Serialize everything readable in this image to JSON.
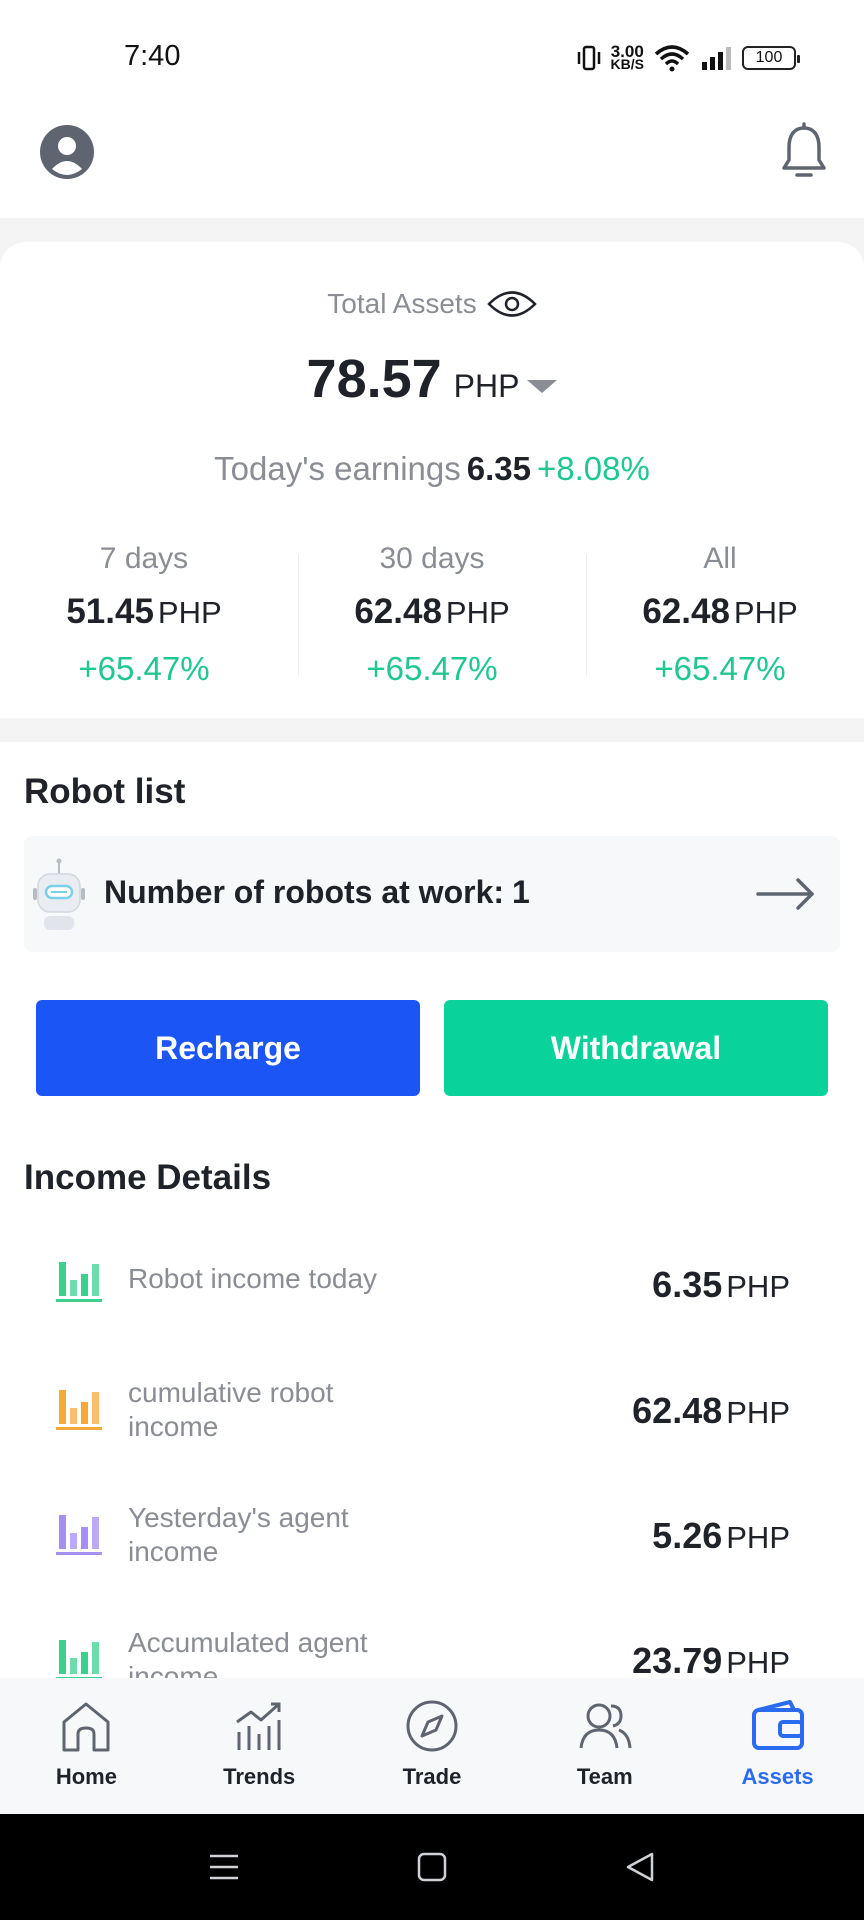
{
  "status": {
    "time": "7:40",
    "net_speed_value": "3.00",
    "net_speed_unit": "KB/S",
    "battery": "100"
  },
  "assets": {
    "total_label": "Total Assets",
    "total_value": "78.57",
    "currency": "PHP",
    "today_label": "Today's earnings",
    "today_value": "6.35",
    "today_percent": "+8.08%",
    "periods": [
      {
        "label": "7 days",
        "value": "51.45",
        "currency": "PHP",
        "percent": "+65.47%"
      },
      {
        "label": "30 days",
        "value": "62.48",
        "currency": "PHP",
        "percent": "+65.47%"
      },
      {
        "label": "All",
        "value": "62.48",
        "currency": "PHP",
        "percent": "+65.47%"
      }
    ]
  },
  "robot_list": {
    "title": "Robot list",
    "text": "Number of robots at work:",
    "count": "1"
  },
  "buttons": {
    "recharge": "Recharge",
    "withdrawal": "Withdrawal"
  },
  "income": {
    "title": "Income Details",
    "rows": [
      {
        "label": "Robot income today",
        "value": "6.35",
        "currency": "PHP",
        "color": "#3ecf8e"
      },
      {
        "label": "cumulative robot income",
        "value": "62.48",
        "currency": "PHP",
        "color": "#f5a93b"
      },
      {
        "label": "Yesterday's agent income",
        "value": "5.26",
        "currency": "PHP",
        "color": "#a58ff0"
      },
      {
        "label": "Accumulated agent income",
        "value": "23.79",
        "currency": "PHP",
        "color": "#3ecf8e"
      }
    ]
  },
  "nav": {
    "items": [
      {
        "label": "Home",
        "icon": "home-icon"
      },
      {
        "label": "Trends",
        "icon": "trends-icon"
      },
      {
        "label": "Trade",
        "icon": "compass-icon"
      },
      {
        "label": "Team",
        "icon": "team-icon"
      },
      {
        "label": "Assets",
        "icon": "wallet-icon",
        "active": true
      }
    ],
    "active_color": "#2b6bf0"
  },
  "colors": {
    "positive": "#1fc793",
    "recharge": "#1b55f5",
    "withdrawal": "#0ad29b"
  }
}
